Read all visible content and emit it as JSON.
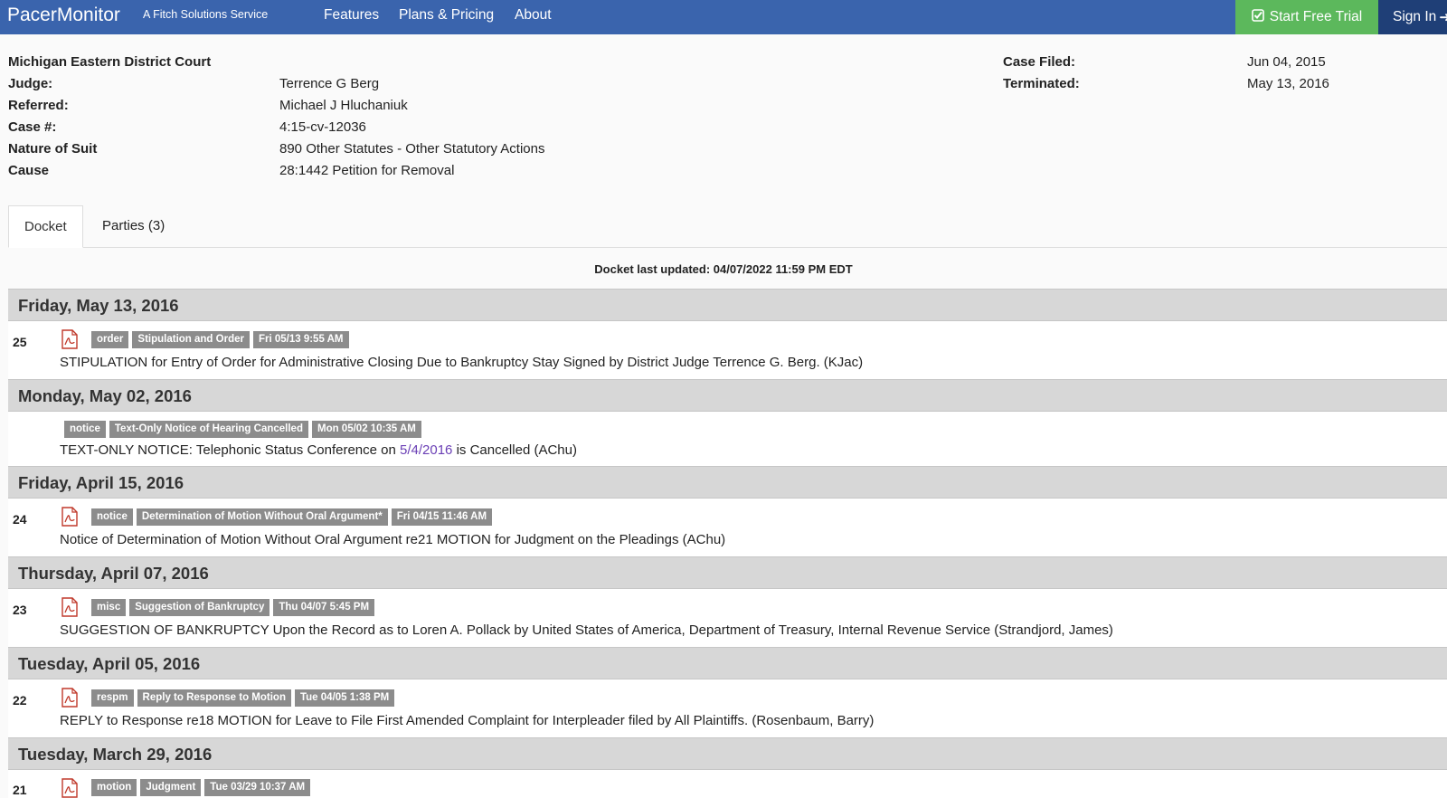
{
  "header": {
    "brand": "PacerMonitor",
    "tagline": "A Fitch Solutions Service",
    "nav": [
      "Features",
      "Plans & Pricing",
      "About"
    ],
    "trial_button": "Start Free Trial",
    "signin_button": "Sign In"
  },
  "case": {
    "court": "Michigan Eastern District Court",
    "judge_label": "Judge:",
    "judge": "Terrence G Berg",
    "referred_label": "Referred:",
    "referred": "Michael J Hluchaniuk",
    "case_no_label": "Case #:",
    "case_no": "4:15-cv-12036",
    "nature_label": "Nature of Suit",
    "nature": "890 Other Statutes - Other Statutory Actions",
    "cause_label": "Cause",
    "cause": "28:1442 Petition for Removal",
    "filed_label": "Case Filed:",
    "filed": "Jun 04, 2015",
    "terminated_label": "Terminated:",
    "terminated": "May 13, 2016"
  },
  "tabs": [
    "Docket",
    "Parties (3)"
  ],
  "docket_updated": "Docket last updated: 04/07/2022 11:59 PM EDT",
  "days": [
    {
      "date": "Friday, May 13, 2016",
      "num": "25",
      "badges": [
        "order",
        "Stipulation and Order",
        "Fri 05/13 9:55 AM"
      ],
      "text": "STIPULATION for Entry of Order for Administrative Closing Due to Bankruptcy Stay Signed by District Judge Terrence G. Berg. (KJac)"
    },
    {
      "date": "Monday, May 02, 2016",
      "num": "",
      "badges": [
        "notice",
        "Text-Only Notice of Hearing Cancelled",
        "Mon 05/02 10:35 AM"
      ],
      "text_pre": "TEXT-ONLY NOTICE: Telephonic Status Conference on ",
      "text_link": "5/4/2016",
      "text_post": " is Cancelled (AChu)"
    },
    {
      "date": "Friday, April 15, 2016",
      "num": "24",
      "badges": [
        "notice",
        "Determination of Motion Without Oral Argument*",
        "Fri 04/15 11:46 AM"
      ],
      "text": "Notice of Determination of Motion Without Oral Argument re21 MOTION for Judgment on the Pleadings (AChu)"
    },
    {
      "date": "Thursday, April 07, 2016",
      "num": "23",
      "badges": [
        "misc",
        "Suggestion of Bankruptcy",
        "Thu 04/07 5:45 PM"
      ],
      "text": "SUGGESTION OF BANKRUPTCY Upon the Record as to Loren A. Pollack by United States of America, Department of Treasury, Internal Revenue Service (Strandjord, James)"
    },
    {
      "date": "Tuesday, April 05, 2016",
      "num": "22",
      "badges": [
        "respm",
        "Reply to Response to Motion",
        "Tue 04/05 1:38 PM"
      ],
      "text": "REPLY to Response re18 MOTION for Leave to File First Amended Complaint for Interpleader filed by All Plaintiffs. (Rosenbaum, Barry)"
    },
    {
      "date": "Tuesday, March 29, 2016",
      "num": "21",
      "badges": [
        "motion",
        "Judgment",
        "Tue 03/29 10:37 AM"
      ]
    }
  ]
}
